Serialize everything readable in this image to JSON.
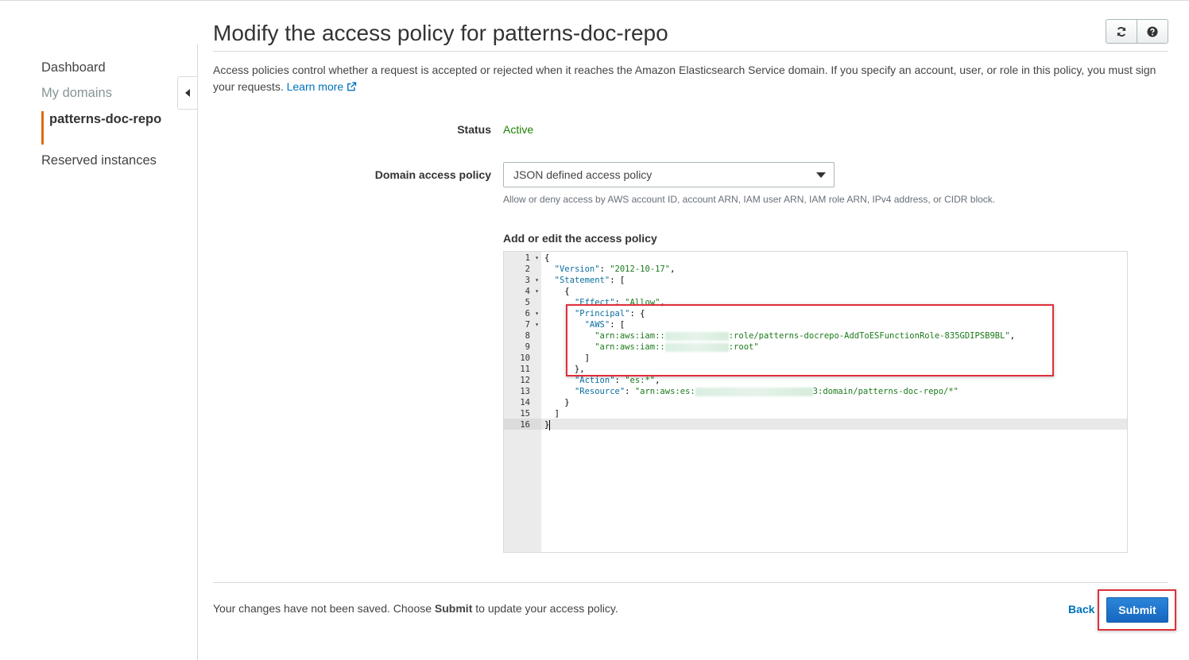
{
  "sidebar": {
    "items": [
      {
        "label": "Dashboard"
      },
      {
        "label": "My domains"
      },
      {
        "label": "patterns-doc-repo"
      },
      {
        "label": "Reserved instances"
      }
    ]
  },
  "header": {
    "title": "Modify the access policy for patterns-doc-repo",
    "refresh_icon": "refresh-icon",
    "help_icon": "help-icon"
  },
  "intro": {
    "text": "Access policies control whether a request is accepted or rejected when it reaches the Amazon Elasticsearch Service domain. If you specify an account, user, or role in this policy, you must sign your requests.",
    "link": "Learn more",
    "link_icon": "external-link-icon"
  },
  "status": {
    "label": "Status",
    "value": "Active",
    "color": "#1d8102"
  },
  "policy": {
    "label": "Domain access policy",
    "selected": "JSON defined access policy",
    "hint": "Allow or deny access by AWS account ID, account ARN, IAM user ARN, IAM role ARN, IPv4 address, or CIDR block."
  },
  "editor": {
    "label": "Add or edit the access policy",
    "line_numbers": [
      "1",
      "2",
      "3",
      "4",
      "5",
      "6",
      "7",
      "8",
      "9",
      "10",
      "11",
      "12",
      "13",
      "14",
      "15",
      "16"
    ],
    "lines": {
      "l1": "{",
      "l2_key": "\"Version\"",
      "l2_val": "\"2012-10-17\"",
      "l3_key": "\"Statement\"",
      "l3_rest": ": [",
      "l4": "    {",
      "l5_key": "\"Effect\"",
      "l5_val": "\"Allow\"",
      "l6_key": "\"Principal\"",
      "l6_rest": ": {",
      "l7_key": "\"AWS\"",
      "l7_rest": ": [",
      "l8_a": "\"arn:aws:iam::",
      "l8_b": ":role/patterns-docrepo-AddToESFunctionRole-835GDIPSB9BL\"",
      "l9_a": "\"arn:aws:iam::",
      "l9_b": ":root\"",
      "l10": "        ]",
      "l11": "      },",
      "l12_key": "\"Action\"",
      "l12_val": "\"es:*\"",
      "l13_key": "\"Resource\"",
      "l13_a": "\"arn:aws:es:",
      "l13_b": "3:domain/patterns-doc-repo/*\"",
      "l14": "    }",
      "l15": "  ]",
      "l16": "}"
    }
  },
  "footer": {
    "msg_prefix": "Your changes have not been saved. Choose ",
    "msg_bold": "Submit",
    "msg_suffix": " to update your access policy.",
    "back": "Back",
    "submit": "Submit"
  }
}
